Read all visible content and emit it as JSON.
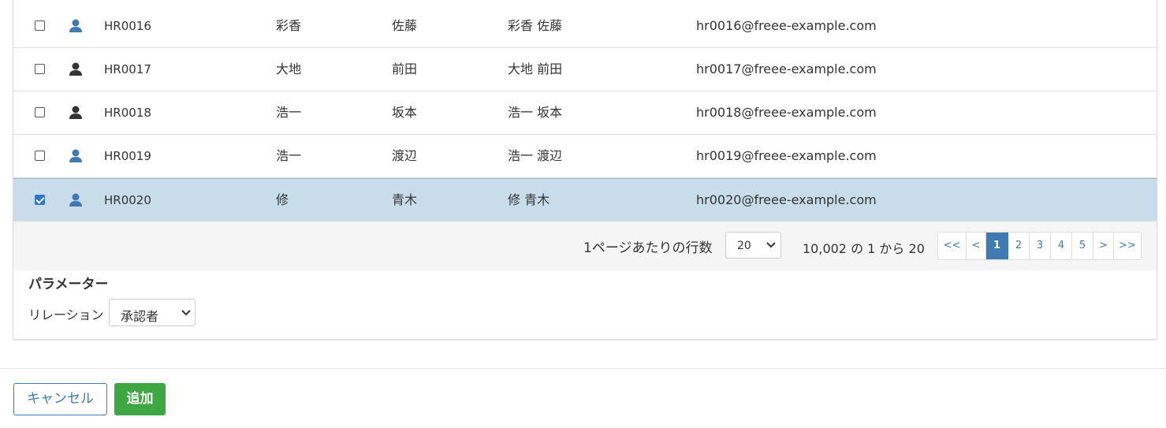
{
  "table": {
    "rows": [
      {
        "id": "HR0016",
        "first_name": "彩香",
        "last_name": "佐藤",
        "full_name": "彩香 佐藤",
        "email": "hr0016@freee-example.com",
        "checked": false,
        "icon_color": "#3f7ab0"
      },
      {
        "id": "HR0017",
        "first_name": "大地",
        "last_name": "前田",
        "full_name": "大地 前田",
        "email": "hr0017@freee-example.com",
        "checked": false,
        "icon_color": "#333333"
      },
      {
        "id": "HR0018",
        "first_name": "浩一",
        "last_name": "坂本",
        "full_name": "浩一 坂本",
        "email": "hr0018@freee-example.com",
        "checked": false,
        "icon_color": "#333333"
      },
      {
        "id": "HR0019",
        "first_name": "浩一",
        "last_name": "渡辺",
        "full_name": "浩一 渡辺",
        "email": "hr0019@freee-example.com",
        "checked": false,
        "icon_color": "#3f7ab0"
      },
      {
        "id": "HR0020",
        "first_name": "修",
        "last_name": "青木",
        "full_name": "修 青木",
        "email": "hr0020@freee-example.com",
        "checked": true,
        "icon_color": "#3f7ab0"
      }
    ]
  },
  "pager": {
    "rows_per_page_label": "1ページあたりの行数",
    "rows_per_page_value": "20",
    "range_text": "10,002 の 1 から 20",
    "buttons": [
      "<<",
      "<",
      "1",
      "2",
      "3",
      "4",
      "5",
      ">",
      ">>"
    ],
    "active_page": "1"
  },
  "parameters": {
    "title": "パラメーター",
    "relation_label": "リレーション",
    "relation_value": "承認者"
  },
  "footer": {
    "cancel_label": "キャンセル",
    "add_label": "追加"
  },
  "colors": {
    "accent": "#3f7ab0",
    "selected_row": "#c8dcea",
    "add_button": "#3ea642",
    "pager_bg": "#f5f5f5"
  }
}
